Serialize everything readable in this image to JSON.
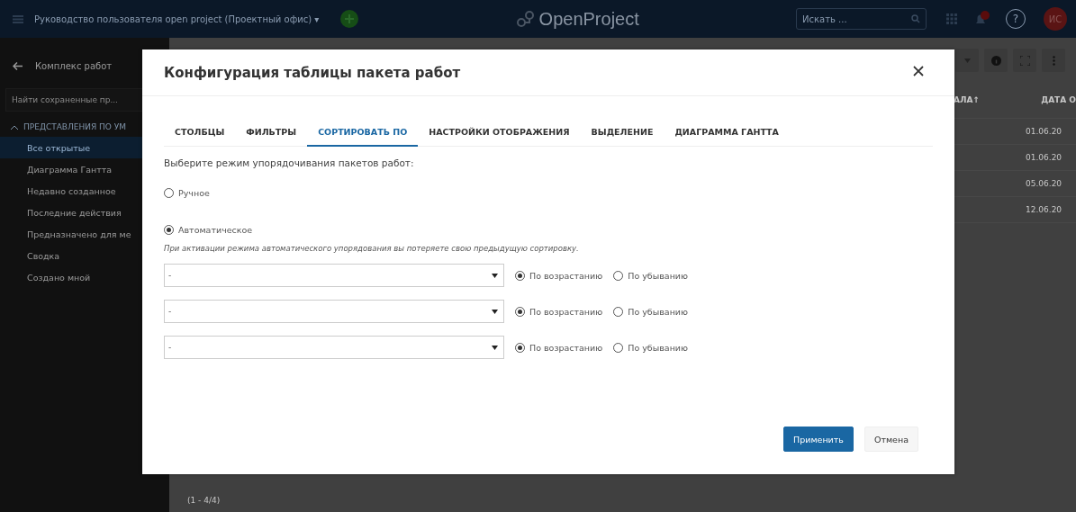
{
  "header": {
    "project": "Руководство пользователя open project (Проектный офис)",
    "logo": "OpenProject",
    "search": {
      "placeholder": "Искать ..."
    },
    "project_caret": "▾",
    "help": "?",
    "notifications": true,
    "avatar": "ИС"
  },
  "sidebar": {
    "back": "Комплекс работ",
    "search": {
      "placeholder": "Найти сохраненные пр..."
    },
    "section": {
      "label": "ПРЕДСТАВЛЕНИЯ ПО УМ",
      "expanded": true
    },
    "items": [
      {
        "label": "Все открытые",
        "selected": true
      },
      {
        "label": "Диаграмма Гантта",
        "selected": false
      },
      {
        "label": "Недавно созданное",
        "selected": false
      },
      {
        "label": "Последние действия",
        "selected": false
      },
      {
        "label": "Предназначено для ме",
        "selected": false
      },
      {
        "label": "Сводка",
        "selected": false
      },
      {
        "label": "Создано мной",
        "selected": false
      }
    ]
  },
  "table": {
    "columns": [
      {
        "label": "АЛА",
        "sort_mark": "↑"
      },
      {
        "label": "ДАТА О"
      }
    ],
    "rows": [
      {
        "date": "01.06.20"
      },
      {
        "date": "01.06.20"
      },
      {
        "date": "05.06.20"
      },
      {
        "date": "12.06.20"
      }
    ],
    "pagination": "(1 - 4/4)"
  },
  "modal": {
    "title": "Конфигурация таблицы пакета работ",
    "tabs": [
      {
        "label": "СТОЛБЦЫ",
        "selected": false
      },
      {
        "label": "ФИЛЬТРЫ",
        "selected": false
      },
      {
        "label": "СОРТИРОВАТЬ ПО",
        "selected": true
      },
      {
        "label": "НАСТРОЙКИ ОТОБРАЖЕНИЯ",
        "selected": false
      },
      {
        "label": "ВЫДЕЛЕНИЕ",
        "selected": false
      },
      {
        "label": "ДИАГРАММА ГАНТТА",
        "selected": false
      }
    ],
    "prompt": "Выберите режим упорядочивания пакетов работ:",
    "modes": [
      {
        "label": "Ручное",
        "selected": false
      },
      {
        "label": "Автоматическое",
        "selected": true
      }
    ],
    "note": "При активации режима автоматического упорядования вы потеряете свою предыдущую сортировку.",
    "sort_rows": [
      {
        "value": "-",
        "options": [
          {
            "label": "По возрастанию",
            "selected": true
          },
          {
            "label": "По убыванию",
            "selected": false
          }
        ]
      },
      {
        "value": "-",
        "options": [
          {
            "label": "По возрастанию",
            "selected": true
          },
          {
            "label": "По убыванию",
            "selected": false
          }
        ]
      },
      {
        "value": "-",
        "options": [
          {
            "label": "По возрастанию",
            "selected": true
          },
          {
            "label": "По убыванию",
            "selected": false
          }
        ]
      }
    ],
    "buttons": [
      {
        "label": "Применить",
        "kind": "primary"
      },
      {
        "label": "Отмена",
        "kind": "secondary"
      }
    ]
  }
}
